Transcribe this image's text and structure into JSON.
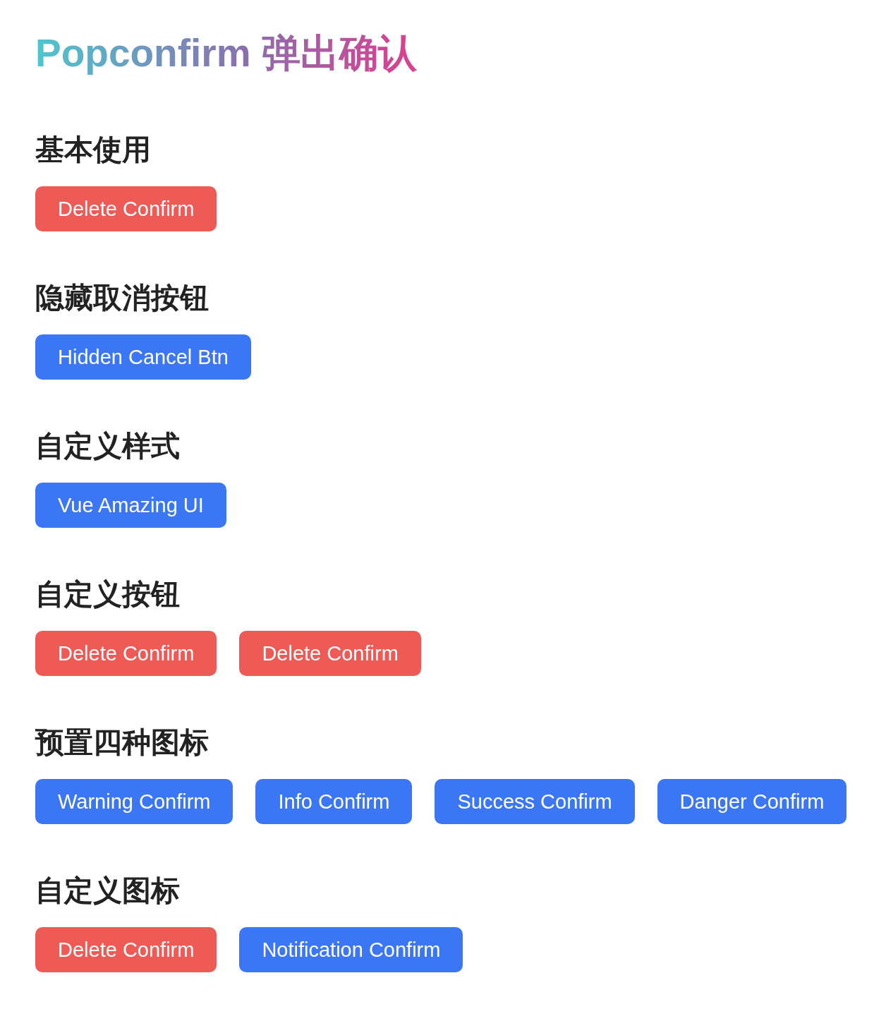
{
  "title": "Popconfirm 弹出确认",
  "sections": [
    {
      "heading": "基本使用",
      "buttons": [
        {
          "label": "Delete Confirm",
          "kind": "danger"
        }
      ]
    },
    {
      "heading": "隐藏取消按钮",
      "buttons": [
        {
          "label": "Hidden Cancel Btn",
          "kind": "primary"
        }
      ]
    },
    {
      "heading": "自定义样式",
      "buttons": [
        {
          "label": "Vue Amazing UI",
          "kind": "primary"
        }
      ]
    },
    {
      "heading": "自定义按钮",
      "buttons": [
        {
          "label": "Delete Confirm",
          "kind": "danger"
        },
        {
          "label": "Delete Confirm",
          "kind": "danger"
        }
      ]
    },
    {
      "heading": "预置四种图标",
      "buttons": [
        {
          "label": "Warning Confirm",
          "kind": "primary"
        },
        {
          "label": "Info Confirm",
          "kind": "primary"
        },
        {
          "label": "Success Confirm",
          "kind": "primary"
        },
        {
          "label": "Danger Confirm",
          "kind": "primary"
        }
      ]
    },
    {
      "heading": "自定义图标",
      "buttons": [
        {
          "label": "Delete Confirm",
          "kind": "danger"
        },
        {
          "label": "Notification Confirm",
          "kind": "primary"
        }
      ]
    }
  ]
}
